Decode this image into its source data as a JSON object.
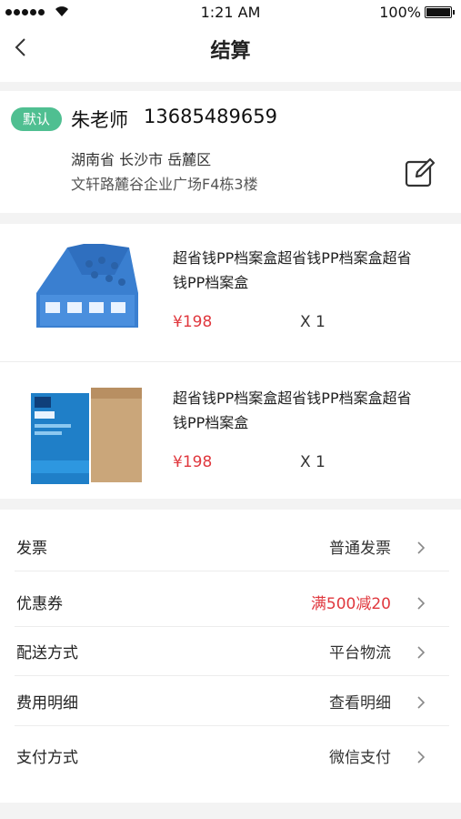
{
  "status_bar": {
    "time": "1:21 AM",
    "battery": "100%"
  },
  "nav": {
    "title": "结算"
  },
  "address": {
    "badge": "默认",
    "name": "朱老师",
    "phone": "13685489659",
    "region": "湖南省 长沙市 岳麓区",
    "street": "文轩路麓谷企业广场F4栋3楼"
  },
  "products": [
    {
      "name": "超省钱PP档案盒超省钱PP档案盒超省钱PP档案盒",
      "price": "¥198",
      "qty": "X 1",
      "image": "blue-file-holder"
    },
    {
      "name": "超省钱PP档案盒超省钱PP档案盒超省钱PP档案盒",
      "price": "¥198",
      "qty": "X 1",
      "image": "a4-paper-box"
    }
  ],
  "options": [
    {
      "label": "发票",
      "value": "普通发票"
    },
    {
      "label": "优惠券",
      "value": "满500减20",
      "color": "#e0383e"
    },
    {
      "label": "配送方式",
      "value": "平台物流"
    },
    {
      "label": "费用明细",
      "value": "查看明细"
    },
    {
      "label": "支付方式",
      "value": "微信支付"
    }
  ]
}
